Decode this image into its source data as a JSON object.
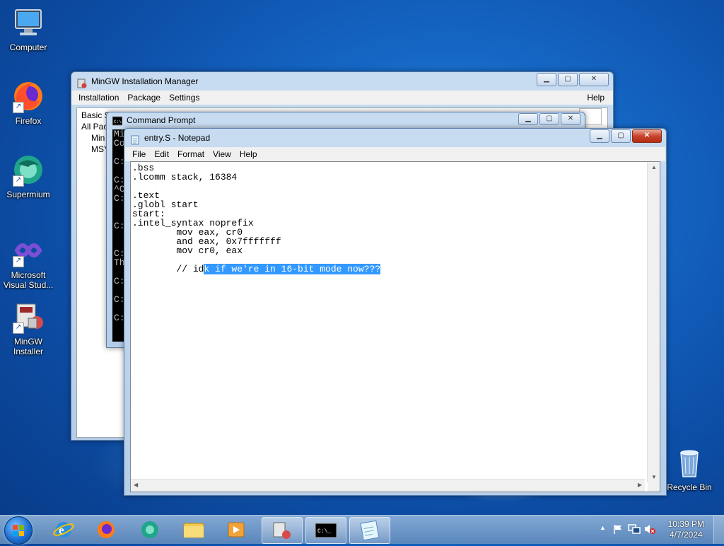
{
  "desktop": {
    "icons": [
      {
        "label": "Computer"
      },
      {
        "label": "Firefox"
      },
      {
        "label": "Supermium"
      },
      {
        "label": "Microsoft Visual Stud..."
      },
      {
        "label": "MinGW Installer"
      },
      {
        "label": "Recycle Bin"
      }
    ]
  },
  "mingw": {
    "title": "MinGW Installation Manager",
    "menu": [
      "Installation",
      "Package",
      "Settings"
    ],
    "help": "Help",
    "tree": [
      "Basic S",
      "All Pac",
      "Min",
      "MSY"
    ]
  },
  "cmd": {
    "title": "Command Prompt",
    "lines": [
      "Mi",
      "Co",
      "",
      "C:",
      "",
      "C:",
      "^C",
      "C:",
      "",
      "",
      "C:",
      "",
      "",
      "C:",
      "Th",
      "",
      "C:",
      "",
      "C:",
      "",
      "C:"
    ]
  },
  "notepad": {
    "title": "entry.S - Notepad",
    "menu": [
      "File",
      "Edit",
      "Format",
      "View",
      "Help"
    ],
    "lines": [
      ".bss",
      ".lcomm stack, 16384",
      "",
      ".text",
      ".globl start",
      "start:",
      ".intel_syntax noprefix",
      "        mov eax, cr0",
      "        and eax, 0x7fffffff",
      "        mov cr0, eax",
      ""
    ],
    "last_line_pre": "        // id",
    "last_line_sel": "k if we're in 16-bit mode now???"
  },
  "taskbar": {
    "time": "10:39 PM",
    "date": "4/7/2024"
  },
  "colors": {
    "selection": "#3399ff",
    "desktop": "#1566c4"
  }
}
